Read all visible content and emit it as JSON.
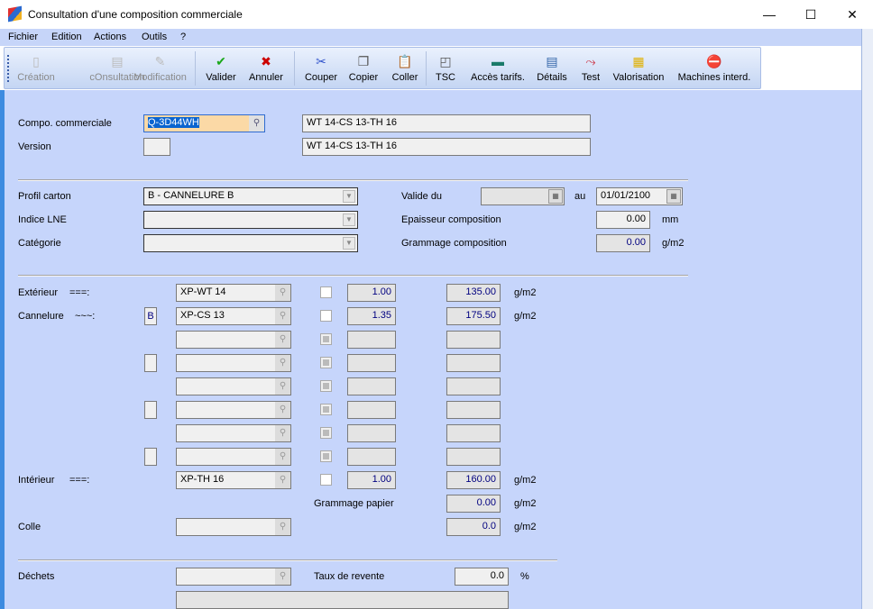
{
  "window": {
    "title": "Consultation d'une composition commerciale",
    "minimize": "—",
    "maximize": "☐",
    "close": "✕"
  },
  "menu": [
    "Fichier",
    "Edition",
    "Actions",
    "Outils",
    "?"
  ],
  "toolbar": [
    {
      "label": "Création",
      "icon": "new-document-icon",
      "glyph": "▯",
      "enabled": false
    },
    {
      "label": "cOnsultation",
      "icon": "consult-icon",
      "glyph": "▤",
      "enabled": false
    },
    {
      "label": "Modification",
      "icon": "edit-icon",
      "glyph": "✎",
      "enabled": false
    },
    {
      "label": "Valider",
      "icon": "check-icon",
      "glyph": "✔",
      "enabled": true,
      "color": "#1aa81a"
    },
    {
      "label": "Annuler",
      "icon": "cross-icon",
      "glyph": "✖",
      "enabled": true,
      "color": "#cc0000"
    },
    {
      "label": "Couper",
      "icon": "scissors-icon",
      "glyph": "✂",
      "enabled": true,
      "color": "#3355cc"
    },
    {
      "label": "Copier",
      "icon": "copy-icon",
      "glyph": "❐",
      "enabled": true
    },
    {
      "label": "Coller",
      "icon": "paste-icon",
      "glyph": "📋",
      "enabled": true
    },
    {
      "label": "TSC",
      "icon": "tsc-icon",
      "glyph": "◰",
      "enabled": true
    },
    {
      "label": "Accès tarifs.",
      "icon": "tariff-icon",
      "glyph": "▬",
      "enabled": true,
      "color": "#1a7a6a"
    },
    {
      "label": "Détails",
      "icon": "details-icon",
      "glyph": "▤",
      "enabled": true,
      "color": "#3366aa"
    },
    {
      "label": "Test",
      "icon": "chart-line-icon",
      "glyph": "⤳",
      "enabled": true,
      "color": "#cc3344"
    },
    {
      "label": "Valorisation",
      "icon": "coins-icon",
      "glyph": "▦",
      "enabled": true,
      "color": "#e0b000"
    },
    {
      "label": "Machines interd.",
      "icon": "forbidden-icon",
      "glyph": "⛔",
      "enabled": true,
      "color": "#e03030"
    }
  ],
  "header": {
    "compo_label": "Compo. commerciale",
    "compo_value": "Q-3D44WH",
    "compo_desc": "WT 14-CS 13-TH 16",
    "version_label": "Version",
    "version_value": "",
    "version_desc": "WT 14-CS 13-TH 16"
  },
  "profile": {
    "profil_label": "Profil carton",
    "profil_value": "B - CANNELURE B",
    "indice_label": "Indice LNE",
    "indice_value": "",
    "categorie_label": "Catégorie",
    "categorie_value": "",
    "valide_label": "Valide du",
    "valide_from": "",
    "au_label": "au",
    "valide_to": "01/01/2100",
    "epaisseur_label": "Epaisseur composition",
    "epaisseur_value": "0.00",
    "epaisseur_unit": "mm",
    "grammage_label": "Grammage composition",
    "grammage_value": "0.00",
    "grammage_unit": "g/m2"
  },
  "layers": [
    {
      "label": "Extérieur",
      "sym": "===:",
      "flute": null,
      "paper": "XP-WT 14",
      "checkbox": "white",
      "coef": "1.00",
      "gram": "135.00",
      "unit": "g/m2"
    },
    {
      "label": "Cannelure",
      "sym": "~~~:",
      "flute": "B",
      "paper": "XP-CS 13",
      "checkbox": "white",
      "coef": "1.35",
      "gram": "175.50",
      "unit": "g/m2"
    },
    {
      "label": "",
      "sym": "",
      "flute": null,
      "paper": "",
      "checkbox": "disabled",
      "coef": "",
      "gram": "",
      "unit": ""
    },
    {
      "label": "",
      "sym": "",
      "flute": "",
      "paper": "",
      "checkbox": "disabled",
      "coef": "",
      "gram": "",
      "unit": ""
    },
    {
      "label": "",
      "sym": "",
      "flute": null,
      "paper": "",
      "checkbox": "disabled",
      "coef": "",
      "gram": "",
      "unit": ""
    },
    {
      "label": "",
      "sym": "",
      "flute": "",
      "paper": "",
      "checkbox": "disabled",
      "coef": "",
      "gram": "",
      "unit": ""
    },
    {
      "label": "",
      "sym": "",
      "flute": null,
      "paper": "",
      "checkbox": "disabled",
      "coef": "",
      "gram": "",
      "unit": ""
    },
    {
      "label": "",
      "sym": "",
      "flute": "",
      "paper": "",
      "checkbox": "disabled",
      "coef": "",
      "gram": "",
      "unit": ""
    },
    {
      "label": "Intérieur",
      "sym": "===:",
      "flute": null,
      "paper": "XP-TH 16",
      "checkbox": "white",
      "coef": "1.00",
      "gram": "160.00",
      "unit": "g/m2"
    }
  ],
  "totals": {
    "grammage_papier_label": "Grammage papier",
    "grammage_papier_value": "0.00",
    "grammage_papier_unit": "g/m2",
    "colle_label": "Colle",
    "colle_value": "",
    "colle_gram": "0.0",
    "colle_unit": "g/m2"
  },
  "dechets": {
    "label": "Déchets",
    "value": "",
    "taux_label": "Taux de revente",
    "taux_value": "0.0",
    "taux_unit": "%",
    "comment": ""
  }
}
